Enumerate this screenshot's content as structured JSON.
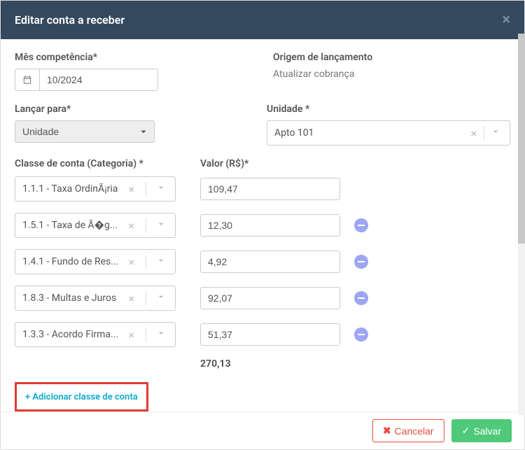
{
  "header": {
    "title": "Editar conta a receber"
  },
  "labels": {
    "mes": "Mês competência*",
    "origem": "Origem de lançamento",
    "lancar": "Lançar para*",
    "unidade": "Unidade *",
    "classe": "Classe de conta (Categoria) *",
    "valor": "Valor (R$)*"
  },
  "mes_value": "10/2024",
  "origem_value": "Atualizar cobrança",
  "lancar_value": "Unidade",
  "unidade_value": "Apto 101",
  "classes": [
    {
      "label": "1.1.1 - Taxa OrdinÃ¡ria",
      "valor": "109,47",
      "removable": false
    },
    {
      "label": "1.5.1 - Taxa de Ã�g...",
      "valor": "12,30",
      "removable": true
    },
    {
      "label": "1.4.1 - Fundo de Res...",
      "valor": "4,92",
      "removable": true
    },
    {
      "label": "1.8.3 - Multas e Juros",
      "valor": "92,07",
      "removable": true
    },
    {
      "label": "1.3.3 - Acordo Firma...",
      "valor": "51,37",
      "removable": true
    }
  ],
  "total": "270,13",
  "add_link": "+ Adicionar classe de conta",
  "footer": {
    "cancel": "Cancelar",
    "save": "Salvar"
  }
}
